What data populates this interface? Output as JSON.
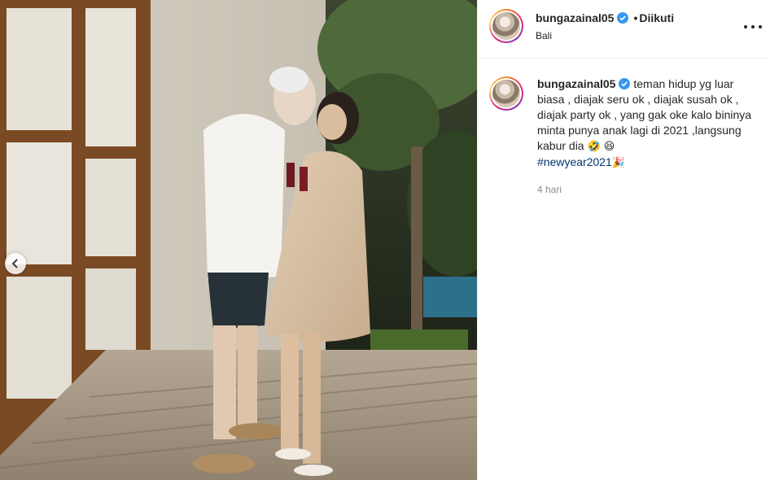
{
  "post": {
    "username": "bungazainal05",
    "follow_status": "Diikuti",
    "separator": "•",
    "location": "Bali",
    "caption_text": "teman hidup yg luar biasa , diajak seru ok , diajak susah ok , diajak party ok , yang gak oke kalo bininya minta punya anak lagi di 2021 ,langsung kabur dia",
    "caption_emojis": "🤣 😆",
    "hashtag": "#newyear2021",
    "hashtag_emoji": "🎉",
    "time_ago": "4 hari"
  },
  "icons": {
    "verified": "verified-badge-icon",
    "more": "more-options-icon",
    "prev": "chevron-left-icon"
  },
  "colors": {
    "verified_blue": "#3897f0",
    "hashtag": "#00376b",
    "muted_text": "#8e8e8e",
    "border": "#efefef"
  }
}
